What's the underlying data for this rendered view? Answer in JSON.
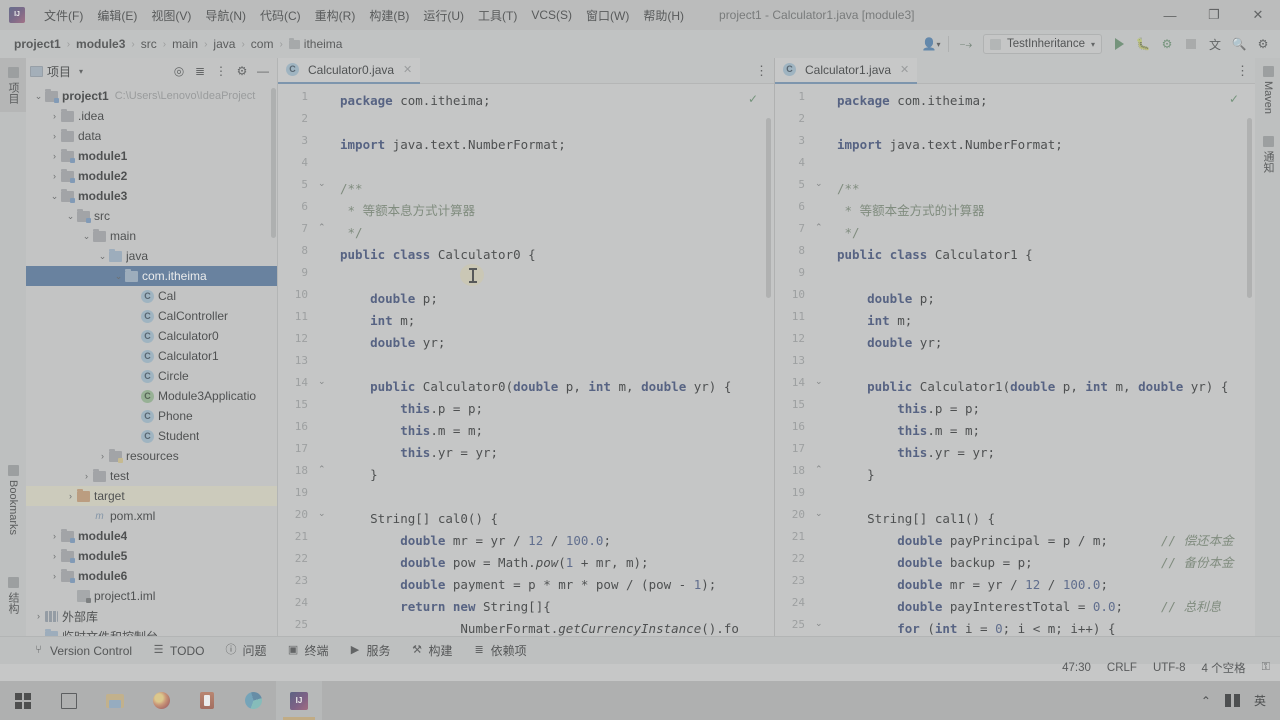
{
  "titlebar": {
    "logo_alt": "IntelliJ IDEA",
    "window_title": "project1 - Calculator1.java [module3]",
    "minimize": "—",
    "maximize": "❐",
    "close": "✕",
    "menu": [
      {
        "label": "文件(F)"
      },
      {
        "label": "编辑(E)"
      },
      {
        "label": "视图(V)"
      },
      {
        "label": "导航(N)"
      },
      {
        "label": "代码(C)"
      },
      {
        "label": "重构(R)"
      },
      {
        "label": "构建(B)"
      },
      {
        "label": "运行(U)"
      },
      {
        "label": "工具(T)"
      },
      {
        "label": "VCS(S)"
      },
      {
        "label": "窗口(W)"
      },
      {
        "label": "帮助(H)"
      }
    ]
  },
  "navbar": {
    "breadcrumbs": [
      {
        "label": "project1",
        "bold": true
      },
      {
        "label": "module3",
        "bold": true
      },
      {
        "label": "src",
        "bold": false
      },
      {
        "label": "main",
        "bold": false
      },
      {
        "label": "java",
        "bold": false
      },
      {
        "label": "com",
        "bold": false
      },
      {
        "label": "itheima",
        "bold": false,
        "folder": true
      }
    ],
    "separator": "›",
    "run_config": {
      "label": "TestInheritance",
      "caret": "▾"
    },
    "buttons": {
      "account": "account-icon",
      "updates": "hammer-icon",
      "run": "run-icon",
      "debug": "debug-icon",
      "run_with_coverage": "coverage-icon",
      "stop": "stop-icon",
      "translate": "translate-icon",
      "search": "search-icon",
      "settings": "settings-icon"
    }
  },
  "left_strip": {
    "tabs": [
      {
        "label": "项目",
        "selected": true
      },
      {
        "label": "Bookmarks",
        "selected": false
      },
      {
        "label": "结构",
        "selected": false
      }
    ]
  },
  "right_strip": {
    "tabs": [
      {
        "label": "Maven"
      },
      {
        "label": "通知"
      }
    ]
  },
  "project_panel": {
    "title": "项目",
    "dropdown_caret": "▾",
    "tools": [
      "locate-icon",
      "expand-all-icon",
      "collapse-all-icon",
      "settings-icon",
      "hide-icon"
    ],
    "tree": [
      {
        "indent": 0,
        "arrow": "⌄",
        "icon": "folder-module",
        "label": "project1",
        "bold": true,
        "path": "C:\\Users\\Lenovo\\IdeaProject",
        "state": "normal"
      },
      {
        "indent": 1,
        "arrow": "›",
        "icon": "folder",
        "label": ".idea",
        "bold": false,
        "state": "normal"
      },
      {
        "indent": 1,
        "arrow": "›",
        "icon": "folder",
        "label": "data",
        "bold": false,
        "state": "normal"
      },
      {
        "indent": 1,
        "arrow": "›",
        "icon": "folder-module",
        "label": "module1",
        "bold": true,
        "state": "normal"
      },
      {
        "indent": 1,
        "arrow": "›",
        "icon": "folder-module",
        "label": "module2",
        "bold": true,
        "state": "normal"
      },
      {
        "indent": 1,
        "arrow": "⌄",
        "icon": "folder-module",
        "label": "module3",
        "bold": true,
        "state": "normal"
      },
      {
        "indent": 2,
        "arrow": "⌄",
        "icon": "folder-src",
        "label": "src",
        "bold": false,
        "state": "normal"
      },
      {
        "indent": 3,
        "arrow": "⌄",
        "icon": "folder",
        "label": "main",
        "bold": false,
        "state": "normal"
      },
      {
        "indent": 4,
        "arrow": "⌄",
        "icon": "folder-blue",
        "label": "java",
        "bold": false,
        "state": "normal"
      },
      {
        "indent": 5,
        "arrow": "⌄",
        "icon": "folder-package",
        "label": "com.itheima",
        "bold": false,
        "state": "selected"
      },
      {
        "indent": 6,
        "arrow": "",
        "icon": "class",
        "label": "Cal",
        "bold": false,
        "state": "normal"
      },
      {
        "indent": 6,
        "arrow": "",
        "icon": "class",
        "label": "CalController",
        "bold": false,
        "state": "normal"
      },
      {
        "indent": 6,
        "arrow": "",
        "icon": "class",
        "label": "Calculator0",
        "bold": false,
        "state": "normal"
      },
      {
        "indent": 6,
        "arrow": "",
        "icon": "class",
        "label": "Calculator1",
        "bold": false,
        "state": "normal"
      },
      {
        "indent": 6,
        "arrow": "",
        "icon": "class",
        "label": "Circle",
        "bold": false,
        "state": "normal"
      },
      {
        "indent": 6,
        "arrow": "",
        "icon": "class-spring",
        "label": "Module3Applicatio",
        "bold": false,
        "state": "normal"
      },
      {
        "indent": 6,
        "arrow": "",
        "icon": "class",
        "label": "Phone",
        "bold": false,
        "state": "normal"
      },
      {
        "indent": 6,
        "arrow": "",
        "icon": "class",
        "label": "Student",
        "bold": false,
        "state": "normal"
      },
      {
        "indent": 4,
        "arrow": "›",
        "icon": "folder-res",
        "label": "resources",
        "bold": false,
        "state": "normal"
      },
      {
        "indent": 3,
        "arrow": "›",
        "icon": "folder",
        "label": "test",
        "bold": false,
        "state": "normal"
      },
      {
        "indent": 2,
        "arrow": "›",
        "icon": "folder-orange",
        "label": "target",
        "bold": false,
        "state": "highlight"
      },
      {
        "indent": 3,
        "arrow": "",
        "icon": "maven",
        "label": "pom.xml",
        "bold": false,
        "state": "normal"
      },
      {
        "indent": 1,
        "arrow": "›",
        "icon": "folder-module",
        "label": "module4",
        "bold": true,
        "state": "normal"
      },
      {
        "indent": 1,
        "arrow": "›",
        "icon": "folder-module",
        "label": "module5",
        "bold": true,
        "state": "normal"
      },
      {
        "indent": 1,
        "arrow": "›",
        "icon": "folder-module",
        "label": "module6",
        "bold": true,
        "state": "normal"
      },
      {
        "indent": 2,
        "arrow": "",
        "icon": "iml",
        "label": "project1.iml",
        "bold": false,
        "state": "normal"
      },
      {
        "indent": 0,
        "arrow": "›",
        "icon": "library",
        "label": "外部库",
        "bold": false,
        "state": "normal"
      },
      {
        "indent": 0,
        "arrow": "",
        "icon": "scratch",
        "label": "临时文件和控制台",
        "bold": false,
        "state": "normal"
      }
    ]
  },
  "editor_left": {
    "tab": {
      "label": "Calculator0.java",
      "icon": "class-icon",
      "close": "✕"
    },
    "more_icon": "⋮",
    "inspection_status": "✓",
    "lines": [
      {
        "n": "1",
        "fold": "",
        "code": "package com.itheima;"
      },
      {
        "n": "2",
        "fold": "",
        "code": ""
      },
      {
        "n": "3",
        "fold": "",
        "code": "import java.text.NumberFormat;"
      },
      {
        "n": "4",
        "fold": "",
        "code": ""
      },
      {
        "n": "5",
        "fold": "⌄",
        "code": "/**"
      },
      {
        "n": "6",
        "fold": "",
        "code": " * 等额本息方式计算器"
      },
      {
        "n": "7",
        "fold": "⌃",
        "code": " */"
      },
      {
        "n": "8",
        "fold": "",
        "code": "public class Calculator0 {"
      },
      {
        "n": "9",
        "fold": "",
        "code": ""
      },
      {
        "n": "10",
        "fold": "",
        "code": "    double p;"
      },
      {
        "n": "11",
        "fold": "",
        "code": "    int m;"
      },
      {
        "n": "12",
        "fold": "",
        "code": "    double yr;"
      },
      {
        "n": "13",
        "fold": "",
        "code": ""
      },
      {
        "n": "14",
        "fold": "⌄",
        "code": "    public Calculator0(double p, int m, double yr) {"
      },
      {
        "n": "15",
        "fold": "",
        "code": "        this.p = p;"
      },
      {
        "n": "16",
        "fold": "",
        "code": "        this.m = m;"
      },
      {
        "n": "17",
        "fold": "",
        "code": "        this.yr = yr;"
      },
      {
        "n": "18",
        "fold": "⌃",
        "code": "    }"
      },
      {
        "n": "19",
        "fold": "",
        "code": ""
      },
      {
        "n": "20",
        "fold": "⌄",
        "code": "    String[] cal0() {"
      },
      {
        "n": "21",
        "fold": "",
        "code": "        double mr = yr / 12 / 100.0;"
      },
      {
        "n": "22",
        "fold": "",
        "code": "        double pow = Math.pow(1 + mr, m);"
      },
      {
        "n": "23",
        "fold": "",
        "code": "        double payment = p * mr * pow / (pow - 1);"
      },
      {
        "n": "24",
        "fold": "",
        "code": "        return new String[]{"
      },
      {
        "n": "25",
        "fold": "",
        "code": "                NumberFormat.getCurrencyInstance().fo"
      }
    ]
  },
  "editor_right": {
    "tab": {
      "label": "Calculator1.java",
      "icon": "class-icon",
      "close": "✕"
    },
    "more_icon": "⋮",
    "inspection_status": "✓",
    "lines": [
      {
        "n": "1",
        "fold": "",
        "code": "package com.itheima;",
        "comment": ""
      },
      {
        "n": "2",
        "fold": "",
        "code": "",
        "comment": ""
      },
      {
        "n": "3",
        "fold": "",
        "code": "import java.text.NumberFormat;",
        "comment": ""
      },
      {
        "n": "4",
        "fold": "",
        "code": "",
        "comment": ""
      },
      {
        "n": "5",
        "fold": "⌄",
        "code": "/**",
        "comment": ""
      },
      {
        "n": "6",
        "fold": "",
        "code": " * 等额本金方式的计算器",
        "comment": ""
      },
      {
        "n": "7",
        "fold": "⌃",
        "code": " */",
        "comment": ""
      },
      {
        "n": "8",
        "fold": "",
        "code": "public class Calculator1 {",
        "comment": ""
      },
      {
        "n": "9",
        "fold": "",
        "code": "",
        "comment": ""
      },
      {
        "n": "10",
        "fold": "",
        "code": "    double p;",
        "comment": ""
      },
      {
        "n": "11",
        "fold": "",
        "code": "    int m;",
        "comment": ""
      },
      {
        "n": "12",
        "fold": "",
        "code": "    double yr;",
        "comment": ""
      },
      {
        "n": "13",
        "fold": "",
        "code": "",
        "comment": ""
      },
      {
        "n": "14",
        "fold": "⌄",
        "code": "    public Calculator1(double p, int m, double yr) {",
        "comment": ""
      },
      {
        "n": "15",
        "fold": "",
        "code": "        this.p = p;",
        "comment": ""
      },
      {
        "n": "16",
        "fold": "",
        "code": "        this.m = m;",
        "comment": ""
      },
      {
        "n": "17",
        "fold": "",
        "code": "        this.yr = yr;",
        "comment": ""
      },
      {
        "n": "18",
        "fold": "⌃",
        "code": "    }",
        "comment": ""
      },
      {
        "n": "19",
        "fold": "",
        "code": "",
        "comment": ""
      },
      {
        "n": "20",
        "fold": "⌄",
        "code": "    String[] cal1() {",
        "comment": ""
      },
      {
        "n": "21",
        "fold": "",
        "code": "        double payPrincipal = p / m;",
        "comment": "// 偿还本金"
      },
      {
        "n": "22",
        "fold": "",
        "code": "        double backup = p;",
        "comment": "// 备份本金"
      },
      {
        "n": "23",
        "fold": "",
        "code": "        double mr = yr / 12 / 100.0;",
        "comment": ""
      },
      {
        "n": "24",
        "fold": "",
        "code": "        double payInterestTotal = 0.0;",
        "comment": "// 总利息"
      },
      {
        "n": "25",
        "fold": "⌄",
        "code": "        for (int i = 0; i < m; i++) {",
        "comment": ""
      }
    ]
  },
  "bottom_bar": {
    "items": [
      {
        "label": "Version Control",
        "icon": "⑂"
      },
      {
        "label": "TODO",
        "icon": "☰"
      },
      {
        "label": "问题",
        "icon": "ⓘ"
      },
      {
        "label": "终端",
        "icon": "▣"
      },
      {
        "label": "服务",
        "icon": "▶"
      },
      {
        "label": "构建",
        "icon": "⚒"
      },
      {
        "label": "依赖项",
        "icon": "≣"
      }
    ]
  },
  "status_bar": {
    "caret_position": "47:30",
    "line_separator": "CRLF",
    "encoding": "UTF-8",
    "indent": "4 个空格",
    "lock_icon": "⚿"
  },
  "taskbar": {
    "apps": [
      {
        "name": "start-button",
        "icon": "windows-icon"
      },
      {
        "name": "task-view-button",
        "icon": "task-view-icon"
      },
      {
        "name": "file-explorer",
        "icon": "explorer-icon"
      },
      {
        "name": "firefox",
        "icon": "firefox-icon"
      },
      {
        "name": "office",
        "icon": "office-icon"
      },
      {
        "name": "edge",
        "icon": "edge-icon"
      },
      {
        "name": "intellij-idea",
        "icon": "idea-icon",
        "active": true
      }
    ],
    "tray": {
      "expand": "⌃",
      "ime_icon": "ime-icon",
      "ime_label": "英"
    }
  }
}
